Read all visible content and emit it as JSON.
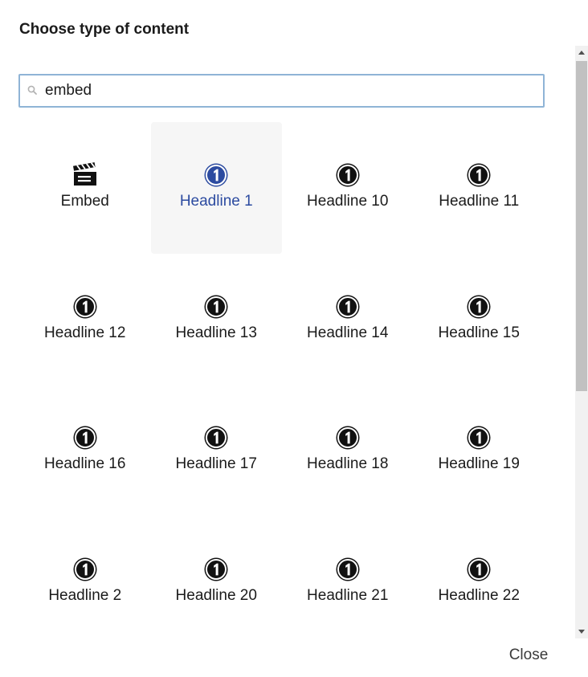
{
  "dialog": {
    "title": "Choose type of content",
    "close_label": "Close"
  },
  "search": {
    "value": "embed",
    "icon": "search-icon"
  },
  "colors": {
    "selected_label": "#2c4ba0",
    "selected_bg": "#f6f6f6",
    "search_border": "#8fb4d6"
  },
  "items": [
    {
      "label": "Embed",
      "icon": "clapperboard-icon",
      "selected": false
    },
    {
      "label": "Headline 1",
      "icon": "number-one-icon",
      "selected": true
    },
    {
      "label": "Headline 10",
      "icon": "number-one-icon",
      "selected": false
    },
    {
      "label": "Headline 11",
      "icon": "number-one-icon",
      "selected": false
    },
    {
      "label": "Headline 12",
      "icon": "number-one-icon",
      "selected": false
    },
    {
      "label": "Headline 13",
      "icon": "number-one-icon",
      "selected": false
    },
    {
      "label": "Headline 14",
      "icon": "number-one-icon",
      "selected": false
    },
    {
      "label": "Headline 15",
      "icon": "number-one-icon",
      "selected": false
    },
    {
      "label": "Headline 16",
      "icon": "number-one-icon",
      "selected": false
    },
    {
      "label": "Headline 17",
      "icon": "number-one-icon",
      "selected": false
    },
    {
      "label": "Headline 18",
      "icon": "number-one-icon",
      "selected": false
    },
    {
      "label": "Headline 19",
      "icon": "number-one-icon",
      "selected": false
    },
    {
      "label": "Headline 2",
      "icon": "number-one-icon",
      "selected": false
    },
    {
      "label": "Headline 20",
      "icon": "number-one-icon",
      "selected": false
    },
    {
      "label": "Headline 21",
      "icon": "number-one-icon",
      "selected": false
    },
    {
      "label": "Headline 22",
      "icon": "number-one-icon",
      "selected": false
    }
  ]
}
